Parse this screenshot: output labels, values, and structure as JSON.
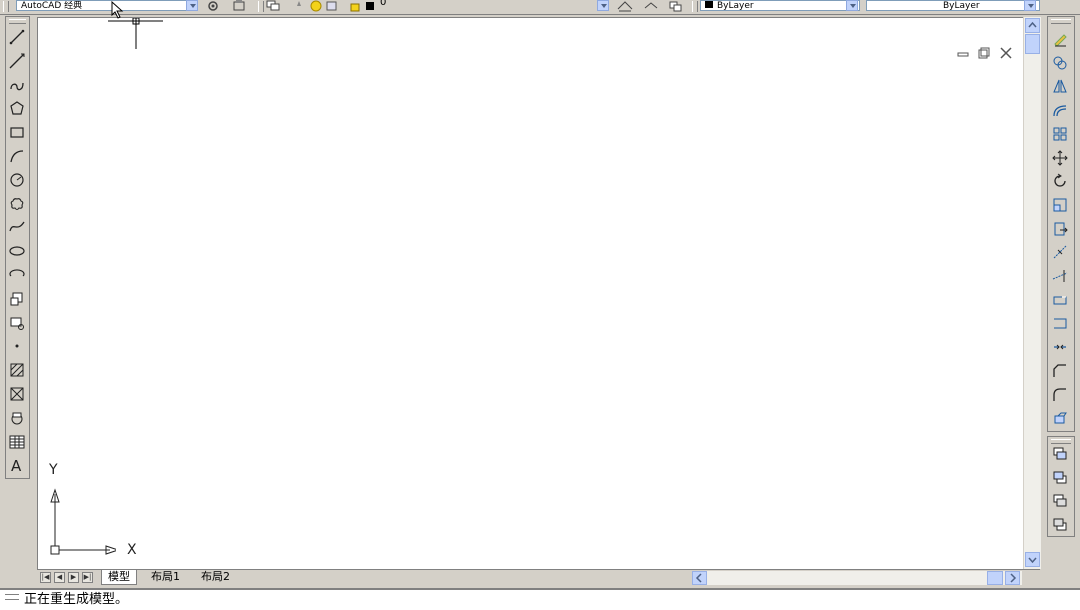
{
  "toolbar": {
    "workspace": "AutoCAD 经典",
    "layer_name": "0",
    "color_value": "ByLayer",
    "linetype_value": "ByLayer"
  },
  "draw_tools": [
    {
      "name": "line-icon"
    },
    {
      "name": "construction-line-icon"
    },
    {
      "name": "polyline-icon"
    },
    {
      "name": "polygon-icon"
    },
    {
      "name": "rectangle-icon"
    },
    {
      "name": "arc-icon"
    },
    {
      "name": "circle-icon"
    },
    {
      "name": "revision-cloud-icon"
    },
    {
      "name": "spline-icon"
    },
    {
      "name": "ellipse-icon"
    },
    {
      "name": "ellipse-arc-icon"
    },
    {
      "name": "insert-block-icon"
    },
    {
      "name": "make-block-icon"
    },
    {
      "name": "point-icon"
    },
    {
      "name": "hatch-icon"
    },
    {
      "name": "gradient-icon"
    },
    {
      "name": "region-icon"
    },
    {
      "name": "table-icon"
    },
    {
      "name": "multiline-text-icon"
    }
  ],
  "modify_tools": [
    {
      "name": "erase-icon"
    },
    {
      "name": "copy-icon"
    },
    {
      "name": "mirror-icon"
    },
    {
      "name": "offset-icon"
    },
    {
      "name": "array-icon"
    },
    {
      "name": "move-icon"
    },
    {
      "name": "rotate-icon"
    },
    {
      "name": "scale-icon"
    },
    {
      "name": "stretch-icon"
    },
    {
      "name": "trim-icon"
    },
    {
      "name": "extend-icon"
    },
    {
      "name": "break-at-point-icon"
    },
    {
      "name": "break-icon"
    },
    {
      "name": "join-icon"
    },
    {
      "name": "chamfer-icon"
    },
    {
      "name": "fillet-icon"
    },
    {
      "name": "explode-icon"
    }
  ],
  "order_tools": [
    {
      "name": "bring-to-front-icon"
    },
    {
      "name": "send-to-back-icon"
    },
    {
      "name": "bring-above-icon"
    },
    {
      "name": "send-under-icon"
    }
  ],
  "tabs": [
    {
      "label": "模型",
      "active": true
    },
    {
      "label": "布局1",
      "active": false
    },
    {
      "label": "布局2",
      "active": false
    }
  ],
  "ucs": {
    "x_label": "X",
    "y_label": "Y"
  },
  "command_line": {
    "text": "正在重生成模型。"
  }
}
